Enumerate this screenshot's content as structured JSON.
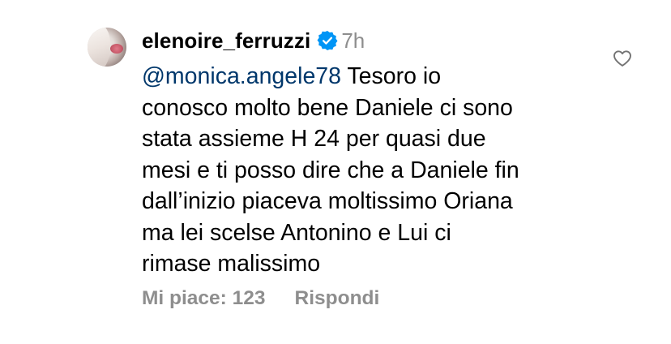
{
  "comment": {
    "username": "elenoire_ferruzzi",
    "verified_icon": "verified-badge-icon",
    "time": "7h",
    "mention": "@monica.angele78",
    "first_line_rest": " Tesoro io",
    "lines": [
      "conosco molto bene Daniele ci sono",
      "stata assieme H 24 per quasi due",
      "mesi e ti posso dire che a Daniele fin",
      "dall’inizio piaceva moltissimo Oriana",
      "ma lei scelse Antonino e Lui ci",
      "rimase malissimo"
    ],
    "likes_label": "Mi piace: 123",
    "reply_label": "Rispondi",
    "like_icon": "heart-outline-icon"
  },
  "colors": {
    "mention": "#00376b",
    "meta": "#8e8e8e",
    "verified": "#0095f6"
  }
}
